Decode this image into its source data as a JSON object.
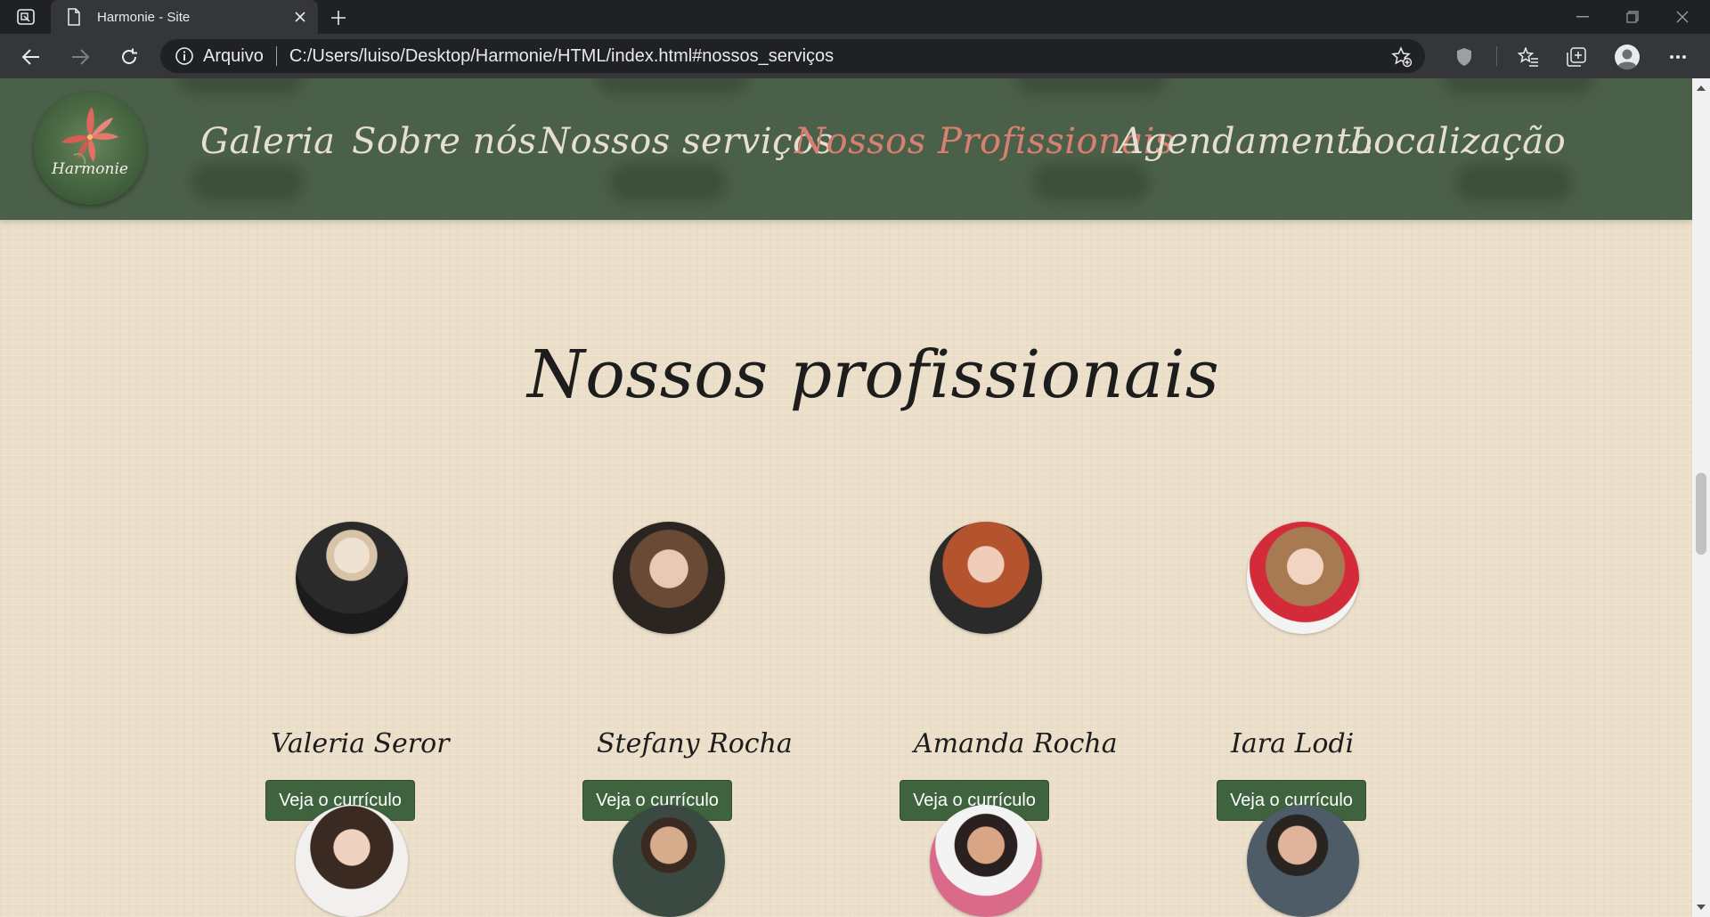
{
  "browser": {
    "tab_title": "Harmonie - Site",
    "site_label": "Arquivo",
    "url": "C:/Users/luiso/Desktop/Harmonie/HTML/index.html#nossos_serviços"
  },
  "site": {
    "logo_text": "Harmonie",
    "nav": {
      "items": [
        {
          "label": "Galeria"
        },
        {
          "label": "Sobre nós"
        },
        {
          "label": "Nossos serviços"
        },
        {
          "label": "Nossos Profissionais"
        },
        {
          "label": "Agendamento"
        },
        {
          "label": "Localização"
        }
      ],
      "active_index": 3
    }
  },
  "section": {
    "title": "Nossos profissionais",
    "professionals": [
      {
        "name": "Valeria Seror",
        "button": "Veja o currículo"
      },
      {
        "name": "Stefany Rocha",
        "button": "Veja o currículo"
      },
      {
        "name": "Amanda Rocha",
        "button": "Veja o currículo"
      },
      {
        "name": "Iara Lodi",
        "button": "Veja o currículo"
      },
      {
        "name": "",
        "button": ""
      },
      {
        "name": "",
        "button": ""
      },
      {
        "name": "",
        "button": ""
      },
      {
        "name": "",
        "button": ""
      }
    ]
  },
  "colors": {
    "navbar_bg": "#4b6048",
    "nav_link": "#e6ded0",
    "nav_link_active": "#d97f72",
    "page_bg": "#ebdfca",
    "button_bg": "#3e633e"
  }
}
